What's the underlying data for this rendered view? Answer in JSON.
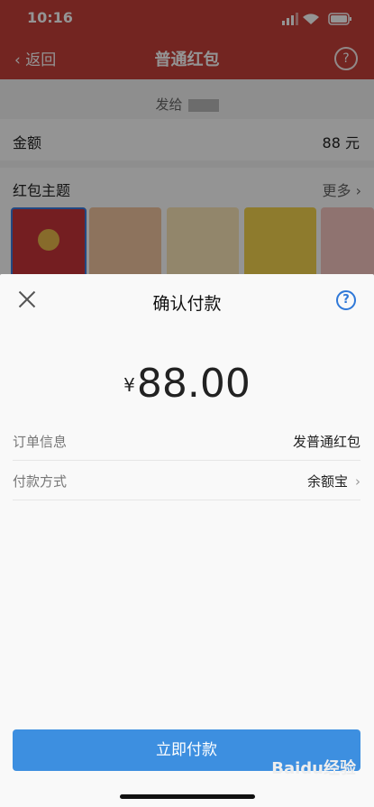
{
  "status": {
    "time": "10:16"
  },
  "nav": {
    "back_label": "返回",
    "title": "普通红包",
    "help_glyph": "?"
  },
  "page": {
    "send_to_label": "发给",
    "amount_label": "金额",
    "amount_value": "88 元",
    "theme_label": "红包主题",
    "theme_more": "更多"
  },
  "sheet": {
    "title": "确认付款",
    "help_glyph": "?",
    "currency_symbol": "¥",
    "amount": "88.00",
    "order_label": "订单信息",
    "order_value": "发普通红包",
    "payment_label": "付款方式",
    "payment_value": "余额宝",
    "pay_button": "立即付款"
  },
  "colors": {
    "header_red": "#c6403a",
    "pay_blue": "#3d8fe0",
    "help_blue": "#2f78d8"
  },
  "watermark": "Baidu经验"
}
